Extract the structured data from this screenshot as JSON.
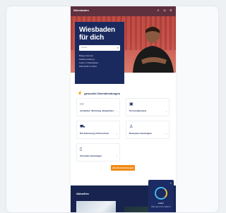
{
  "header": {
    "brand": "Wiesbaden",
    "icons": [
      "search-icon",
      "user-icon",
      "menu-icon"
    ]
  },
  "hero": {
    "title": "Wiesbaden für dich",
    "search_placeholder": "Suche",
    "quick_links": [
      "Bürger-Service",
      "Stadtverwaltung",
      "Leben in Wiesbaden",
      "Wirtschaft & Arbeit"
    ]
  },
  "services": {
    "title": "gesuchte Dienstleistungen",
    "tiles": [
      {
        "icon": "document-icon",
        "label": "Anmelden: Wohnung, Bürgerbüro"
      },
      {
        "icon": "id-card-icon",
        "label": "Personalausweis"
      },
      {
        "icon": "car-icon",
        "label": "Kfz-Zulassung, Führerschein"
      },
      {
        "icon": "person-icon",
        "label": "Reisepass beantragen"
      },
      {
        "icon": "doc-icon",
        "label": "Urkunden beantragen"
      }
    ],
    "more_button": "Alle Dienstleistungen"
  },
  "footer": {
    "title": "Aktuelles"
  },
  "chat": {
    "line1": "Hallo!",
    "line2": "Wie kann ich helfen?"
  },
  "colors": {
    "primary": "#1b2a5e",
    "accent": "#f08a14",
    "hero_red": "#c9524a"
  }
}
